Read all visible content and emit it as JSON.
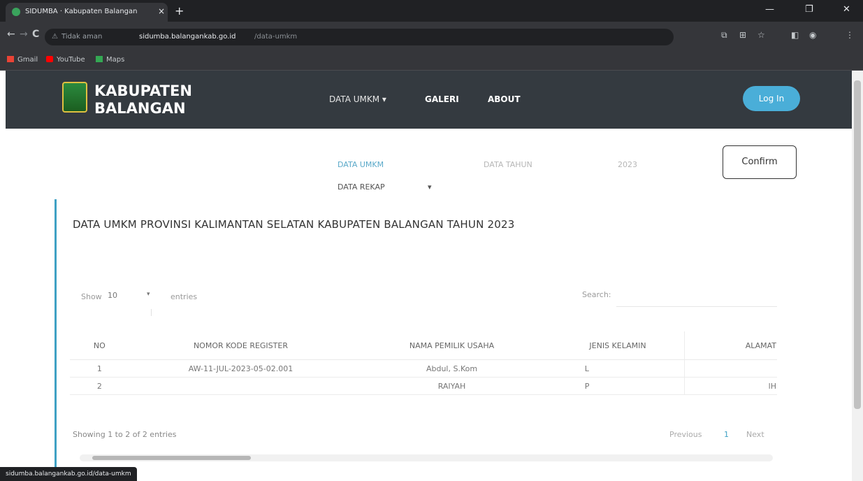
{
  "browser": {
    "tab_title": "SIDUMBA · Kabupaten Balangan",
    "tab_close": "×",
    "new_tab": "+",
    "window_controls": [
      "—",
      "❐",
      "✕"
    ],
    "nav_buttons": [
      "←",
      "→",
      "C"
    ],
    "security": "Tidak aman",
    "domain": "sidumba.balangankab.go.id",
    "path": "/data-umkm",
    "extension_icons": [
      "⧉",
      "⊞",
      "☆",
      "◧",
      "◉",
      "⋮"
    ],
    "bookmarks": [
      {
        "label": "Gmail",
        "icon": "gmail-icon",
        "color": "#ea4335"
      },
      {
        "label": "YouTube",
        "icon": "youtube-icon",
        "color": "#ff0000"
      },
      {
        "label": "Maps",
        "icon": "maps-icon",
        "color": "#34a853"
      }
    ],
    "status_url": "sidumba.balangankab.go.id/data-umkm"
  },
  "site": {
    "brand_line1": "KABUPATEN",
    "brand_line2": "BALANGAN",
    "menu": [
      {
        "label": "DATA UMKM ▾"
      },
      {
        "label": "GALERI"
      },
      {
        "label": "ABOUT"
      }
    ],
    "login_label": "Log In",
    "accent_color": "#4aaed8",
    "navbar_color": "#343a40"
  },
  "filters": {
    "data_umkm": "DATA UMKM",
    "data_tahun": "DATA TAHUN",
    "year": "2023",
    "data_rekap": "DATA REKAP",
    "rekap_caret": "▾",
    "confirm_label": "Confirm"
  },
  "page": {
    "title": "DATA UMKM PROVINSI KALIMANTAN SELATAN KABUPATEN BALANGAN TAHUN 2023"
  },
  "datatable": {
    "show_label": "Show",
    "entries_value": "10",
    "entries_caret": "▾",
    "entries_label": "entries",
    "search_label": "Search:",
    "columns": [
      "NO",
      "NOMOR KODE REGISTER",
      "NAMA PEMILIK USAHA",
      "JENIS KELAMIN",
      "ALAMAT"
    ],
    "rows": [
      [
        "1",
        "AW-11-JUL-2023-05-02.001",
        "Abdul, S.Kom",
        "L",
        ""
      ],
      [
        "2",
        "",
        "RAIYAH",
        "P",
        "lH"
      ]
    ],
    "info": "Showing 1 to 2 of 2 entries",
    "prev": "Previous",
    "page": "1",
    "next": "Next"
  }
}
